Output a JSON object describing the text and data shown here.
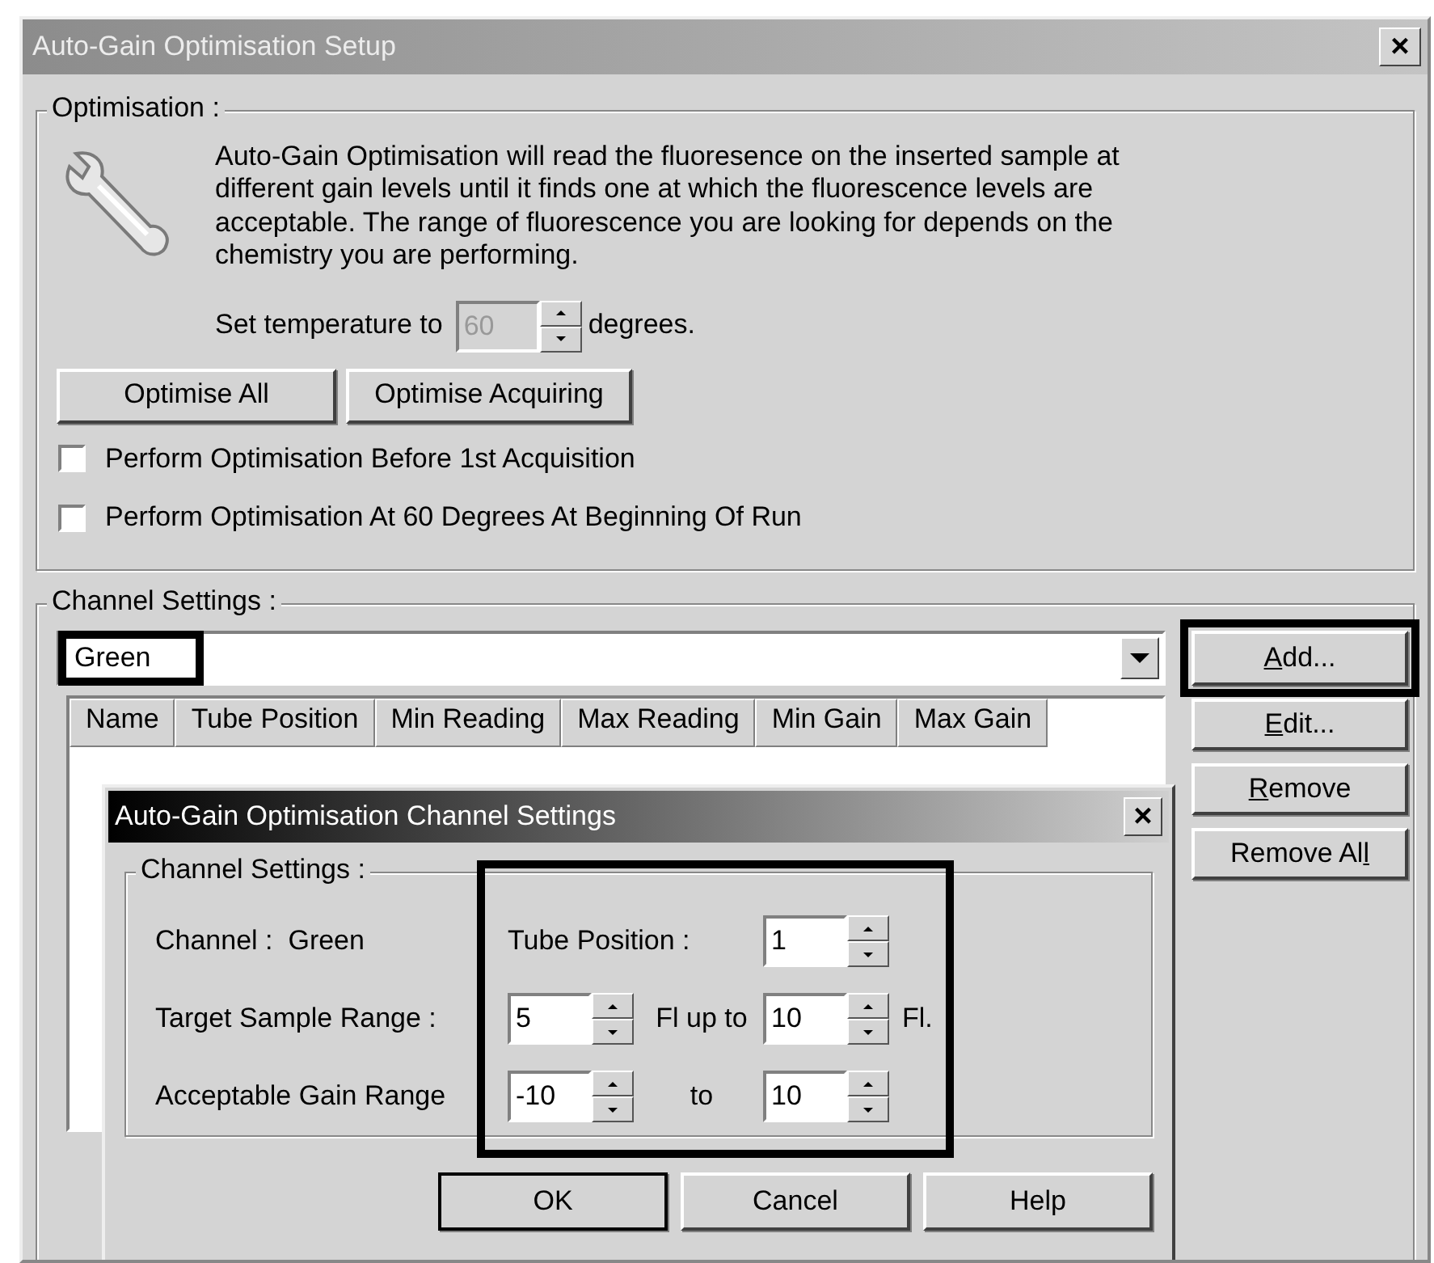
{
  "window": {
    "title": "Auto-Gain Optimisation Setup",
    "close": "×"
  },
  "optimisation": {
    "legend": "Optimisation :",
    "description": "Auto-Gain Optimisation will read the fluoresence on the inserted sample at different gain levels until it finds one at which the fluorescence levels are acceptable. The range of fluorescence you are looking for depends on the chemistry you are performing.",
    "temperature": {
      "label": "Set temperature to",
      "value": "60",
      "disabled": true,
      "unit": "degrees."
    },
    "buttons": [
      {
        "label": "Optimise All"
      },
      {
        "label": "Optimise Acquiring"
      }
    ],
    "options": [
      {
        "label": "Perform Optimisation Before 1st Acquisition",
        "checked": false
      },
      {
        "label": "Perform Optimisation At 60 Degrees At Beginning Of Run",
        "checked": false
      }
    ]
  },
  "channel_settings": {
    "legend": "Channel Settings :",
    "channel": {
      "value": "Green",
      "highlighted": true
    },
    "columns": [
      "Name",
      "Tube Position",
      "Min Reading",
      "Max Reading",
      "Min Gain",
      "Max Gain"
    ],
    "buttons": [
      {
        "access_key": "A",
        "label_rest": "dd...",
        "highlighted": true
      },
      {
        "access_key": "E",
        "label_rest": "dit...",
        "highlighted": false
      },
      {
        "access_key": "R",
        "label_rest": "emove",
        "highlighted": false
      },
      {
        "label_start": "Remove Al",
        "access_key": "l",
        "highlighted": false
      }
    ]
  },
  "dialog": {
    "title": "Auto-Gain Optimisation Channel Settings",
    "close": "×",
    "legend": "Channel Settings :",
    "highlighted": true,
    "channel": {
      "label": "Channel :",
      "value": "Green"
    },
    "tube_position": {
      "label": "Tube Position :",
      "value": "1"
    },
    "ranges": [
      {
        "label": "Target Sample Range :",
        "low": "5",
        "joiner": "Fl up to",
        "high": "10",
        "unit": "Fl."
      },
      {
        "label": "Acceptable Gain Range",
        "low": "-10",
        "joiner": "to",
        "high": "10"
      }
    ],
    "buttons": [
      {
        "label": "OK",
        "default": true
      },
      {
        "label": "Cancel",
        "default": false
      },
      {
        "label": "Help",
        "default": false
      }
    ]
  }
}
